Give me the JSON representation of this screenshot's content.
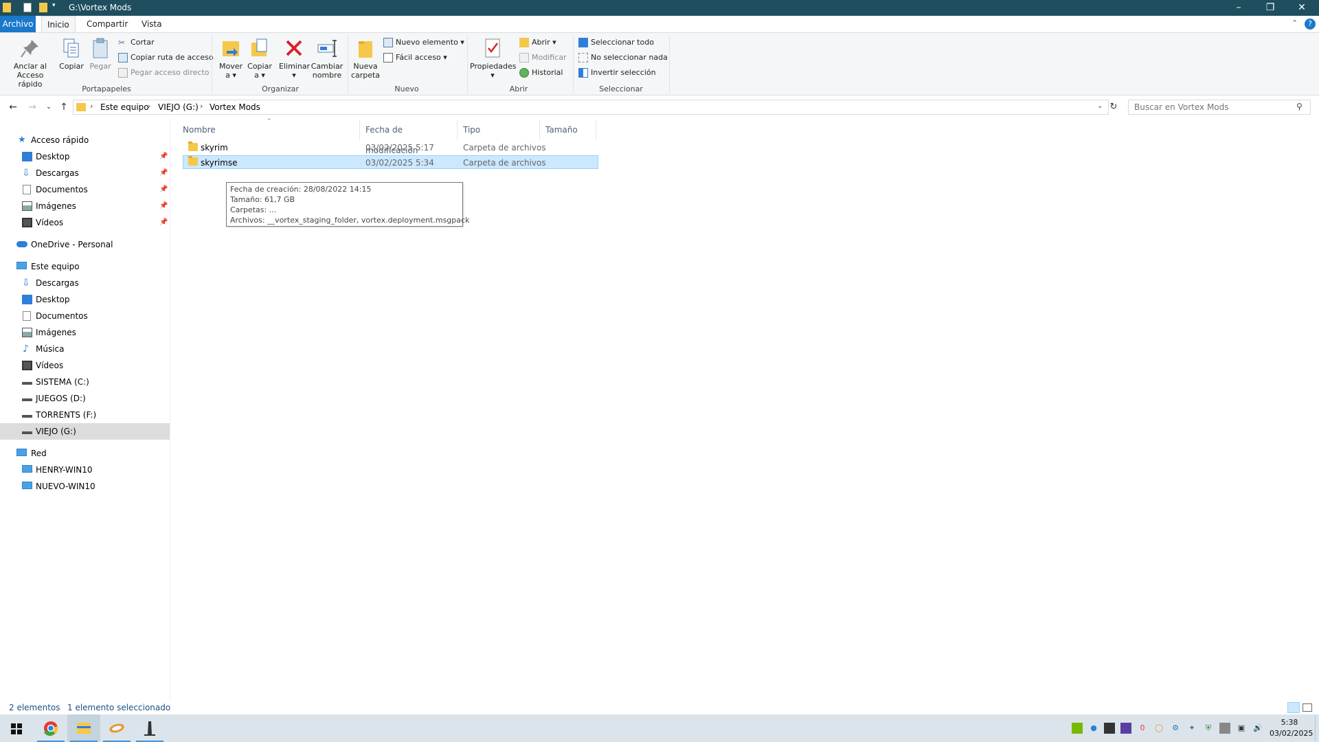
{
  "window": {
    "title": "G:\\Vortex Mods",
    "colors": {
      "titlebar": "#1f4e5f",
      "accent": "#1979ca",
      "selection": "#cce8ff"
    }
  },
  "tabs": [
    {
      "label": "Archivo"
    },
    {
      "label": "Inicio"
    },
    {
      "label": "Compartir"
    },
    {
      "label": "Vista"
    }
  ],
  "ribbon": {
    "portapapeles": {
      "label": "Portapapeles",
      "pin_label_1": "Anclar al",
      "pin_label_2": "Acceso rápido",
      "copy": "Copiar",
      "paste": "Pegar",
      "cut": "Cortar",
      "copy_path": "Copiar ruta de acceso",
      "paste_shortcut": "Pegar acceso directo"
    },
    "organizar": {
      "label": "Organizar",
      "move_1": "Mover",
      "move_2": "a ▾",
      "copyto_1": "Copiar",
      "copyto_2": "a ▾",
      "delete": "Eliminar",
      "delete_arrow": "▾",
      "rename_1": "Cambiar",
      "rename_2": "nombre"
    },
    "nuevo": {
      "label": "Nuevo",
      "new_folder_1": "Nueva",
      "new_folder_2": "carpeta",
      "new_item": "Nuevo elemento ▾",
      "easy_access": "Fácil acceso ▾"
    },
    "abrir": {
      "label": "Abrir",
      "properties": "Propiedades",
      "properties_arrow": "▾",
      "open": "Abrir ▾",
      "edit": "Modificar",
      "history": "Historial"
    },
    "seleccionar": {
      "label": "Seleccionar",
      "select_all": "Seleccionar todo",
      "select_none": "No seleccionar nada",
      "invert": "Invertir selección"
    }
  },
  "address": {
    "crumbs": [
      "Este equipo",
      "VIEJO (G:)",
      "Vortex Mods"
    ],
    "search_placeholder": "Buscar en Vortex Mods"
  },
  "nav": {
    "quick_access": "Acceso rápido",
    "quick_items": [
      "Desktop",
      "Descargas",
      "Documentos",
      "Imágenes",
      "Vídeos"
    ],
    "onedrive": "OneDrive - Personal",
    "this_pc": "Este equipo",
    "pc_items": [
      "Descargas",
      "Desktop",
      "Documentos",
      "Imágenes",
      "Música",
      "Vídeos",
      "SISTEMA (C:)",
      "JUEGOS (D:)",
      "TORRENTS (F:)",
      "VIEJO (G:)"
    ],
    "network": "Red",
    "network_items": [
      "HENRY-WIN10",
      "NUEVO-WIN10"
    ]
  },
  "columns": [
    "Nombre",
    "Fecha de modificación",
    "Tipo",
    "Tamaño"
  ],
  "files": [
    {
      "name": "skyrim",
      "date": "03/02/2025 5:17",
      "type": "Carpeta de archivos",
      "size": ""
    },
    {
      "name": "skyrimse",
      "date": "03/02/2025 5:34",
      "type": "Carpeta de archivos",
      "size": ""
    }
  ],
  "tooltip": {
    "line1": "Fecha de creación: 28/08/2022 14:15",
    "line2": "Tamaño: 61,7 GB",
    "line3": "Carpetas: ...",
    "line4": "Archivos: __vortex_staging_folder, vortex.deployment.msgpack"
  },
  "status": {
    "count": "2 elementos",
    "selected": "1 elemento seleccionado"
  },
  "taskbar": {
    "time": "5:38",
    "date": "03/02/2025",
    "tray_badge": "0"
  }
}
